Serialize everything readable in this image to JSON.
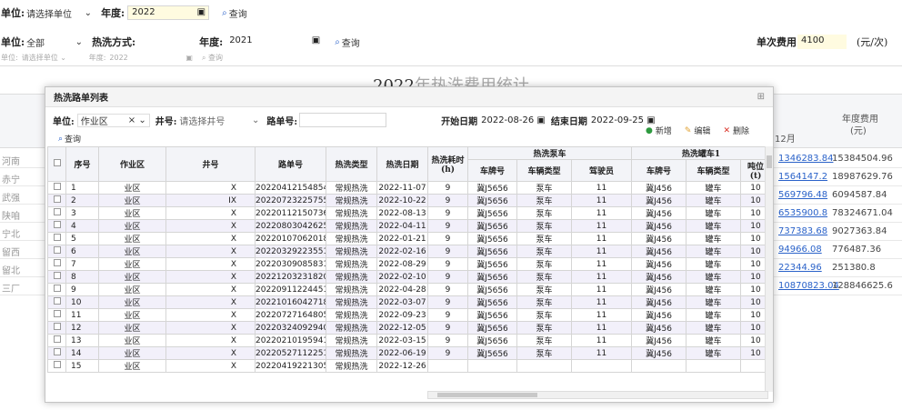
{
  "top1": {
    "unit_label": "单位:",
    "unit_value": "请选择单位",
    "year_label": "年度:",
    "year_value": "2022",
    "query": "查询"
  },
  "top2": {
    "unit_label": "单位:",
    "unit_value": "全部",
    "method_label": "热洗方式:",
    "year_label": "年度:",
    "year_value": "2021",
    "query": "查询",
    "fee_label": "单次费用:",
    "fee_value": "4100",
    "fee_unit": "(元/次)"
  },
  "top3": {
    "unit_label": "单位:",
    "unit_value": "请选择单位",
    "year_label": "年度:",
    "year_value": "2022",
    "query": "查询"
  },
  "bg": {
    "title_dark": "2022",
    "title_light": "年热洗费用统计",
    "col_dec": "12月",
    "col_year": "年度费用",
    "col_year_unit": "(元)",
    "rows": [
      {
        "name": "河南",
        "dec": "1346283.84",
        "year": "15384504.96"
      },
      {
        "name": "赤宁",
        "dec": "1564147.2",
        "year": "18987629.76"
      },
      {
        "name": "武强",
        "dec": "569796.48",
        "year": "6094587.84"
      },
      {
        "name": "陕咱",
        "dec": "6535900.8",
        "year": "78324671.04"
      },
      {
        "name": "宁北",
        "dec": "737383.68",
        "year": "9027363.84"
      },
      {
        "name": "留西",
        "dec": "94966.08",
        "year": "776487.36"
      },
      {
        "name": "留北",
        "dec": "22344.96",
        "year": "251380.8"
      },
      {
        "name": "三厂",
        "dec": "10870823.04",
        "year": "128846625.6"
      }
    ]
  },
  "dialog": {
    "title": "热洗路单列表",
    "unit_label": "单位:",
    "unit_value": "作业区",
    "well_label": "井号:",
    "well_placeholder": "请选择井号",
    "route_label": "路单号:",
    "start_label": "开始日期",
    "start_value": "2022-08-26",
    "end_label": "结束日期",
    "end_value": "2022-09-25",
    "add": "新增",
    "edit": "编辑",
    "del": "删除",
    "query": "查询",
    "headers": {
      "seq": "序号",
      "area": "作业区",
      "well": "井号",
      "route": "路单号",
      "type": "热洗类型",
      "date": "热洗日期",
      "dur": "热洗耗时",
      "dur_unit": "(h)",
      "pump_group": "热洗泵车",
      "tank_group": "热洗罐车1",
      "plate": "车牌号",
      "vtype": "车辆类型",
      "driver": "驾驶员",
      "plate2": "车牌号",
      "vtype2": "车辆类型",
      "ton": "吨位",
      "ton_unit": "(t)"
    },
    "rows": [
      {
        "n": "1",
        "a": "业区",
        "w": "X",
        "r": "20220412154854",
        "t": "常规热洗",
        "d": "2022-11-07",
        "h": "9",
        "p": "冀J5656",
        "v": "泵车",
        "dr": "11",
        "p2": "冀J456",
        "v2": "罐车",
        "ton": "10"
      },
      {
        "n": "2",
        "a": "业区",
        "w": "IX",
        "r": "20220723225755",
        "t": "常规热洗",
        "d": "2022-10-22",
        "h": "9",
        "p": "冀J5656",
        "v": "泵车",
        "dr": "11",
        "p2": "冀J456",
        "v2": "罐车",
        "ton": "10"
      },
      {
        "n": "3",
        "a": "业区",
        "w": "X",
        "r": "20220112150736",
        "t": "常规热洗",
        "d": "2022-08-13",
        "h": "9",
        "p": "冀J5656",
        "v": "泵车",
        "dr": "11",
        "p2": "冀J456",
        "v2": "罐车",
        "ton": "10"
      },
      {
        "n": "4",
        "a": "业区",
        "w": "X",
        "r": "20220803042625",
        "t": "常规热洗",
        "d": "2022-04-11",
        "h": "9",
        "p": "冀J5656",
        "v": "泵车",
        "dr": "11",
        "p2": "冀J456",
        "v2": "罐车",
        "ton": "10"
      },
      {
        "n": "5",
        "a": "业区",
        "w": "X",
        "r": "20220107062018",
        "t": "常规热洗",
        "d": "2022-01-21",
        "h": "9",
        "p": "冀J5656",
        "v": "泵车",
        "dr": "11",
        "p2": "冀J456",
        "v2": "罐车",
        "ton": "10"
      },
      {
        "n": "6",
        "a": "业区",
        "w": "X",
        "r": "20220329223551",
        "t": "常规热洗",
        "d": "2022-02-16",
        "h": "9",
        "p": "冀J5656",
        "v": "泵车",
        "dr": "11",
        "p2": "冀J456",
        "v2": "罐车",
        "ton": "10"
      },
      {
        "n": "7",
        "a": "业区",
        "w": "X",
        "r": "20220309085831",
        "t": "常规热洗",
        "d": "2022-08-29",
        "h": "9",
        "p": "冀J5656",
        "v": "泵车",
        "dr": "11",
        "p2": "冀J456",
        "v2": "罐车",
        "ton": "10"
      },
      {
        "n": "8",
        "a": "业区",
        "w": "X",
        "r": "20221203231820",
        "t": "常规热洗",
        "d": "2022-02-10",
        "h": "9",
        "p": "冀J5656",
        "v": "泵车",
        "dr": "11",
        "p2": "冀J456",
        "v2": "罐车",
        "ton": "10"
      },
      {
        "n": "9",
        "a": "业区",
        "w": "X",
        "r": "20220911224451",
        "t": "常规热洗",
        "d": "2022-04-28",
        "h": "9",
        "p": "冀J5656",
        "v": "泵车",
        "dr": "11",
        "p2": "冀J456",
        "v2": "罐车",
        "ton": "10"
      },
      {
        "n": "10",
        "a": "业区",
        "w": "X",
        "r": "20221016042718",
        "t": "常规热洗",
        "d": "2022-03-07",
        "h": "9",
        "p": "冀J5656",
        "v": "泵车",
        "dr": "11",
        "p2": "冀J456",
        "v2": "罐车",
        "ton": "10"
      },
      {
        "n": "11",
        "a": "业区",
        "w": "X",
        "r": "20220727164805",
        "t": "常规热洗",
        "d": "2022-09-23",
        "h": "9",
        "p": "冀J5656",
        "v": "泵车",
        "dr": "11",
        "p2": "冀J456",
        "v2": "罐车",
        "ton": "10"
      },
      {
        "n": "12",
        "a": "业区",
        "w": "X",
        "r": "20220324092940",
        "t": "常规热洗",
        "d": "2022-12-05",
        "h": "9",
        "p": "冀J5656",
        "v": "泵车",
        "dr": "11",
        "p2": "冀J456",
        "v2": "罐车",
        "ton": "10"
      },
      {
        "n": "13",
        "a": "业区",
        "w": "X",
        "r": "20220210195941",
        "t": "常规热洗",
        "d": "2022-03-15",
        "h": "9",
        "p": "冀J5656",
        "v": "泵车",
        "dr": "11",
        "p2": "冀J456",
        "v2": "罐车",
        "ton": "10"
      },
      {
        "n": "14",
        "a": "业区",
        "w": "X",
        "r": "20220527112251",
        "t": "常规热洗",
        "d": "2022-06-19",
        "h": "9",
        "p": "冀J5656",
        "v": "泵车",
        "dr": "11",
        "p2": "冀J456",
        "v2": "罐车",
        "ton": "10"
      },
      {
        "n": "15",
        "a": "业区",
        "w": "X",
        "r": "20220419221305",
        "t": "常规热洗",
        "d": "2022-12-26",
        "h": "",
        "p": "",
        "v": "",
        "dr": "",
        "p2": "",
        "v2": "",
        "ton": ""
      }
    ]
  },
  "colors": {
    "link": "#2a62c9",
    "row_alt": "#f2f0fa",
    "header_bg": "#f3f4f8",
    "delete": "#d93025",
    "add": "#2e9a3f"
  },
  "icons": [
    "search-icon",
    "calendar-icon",
    "chevron-down-icon",
    "close-icon",
    "add-icon",
    "edit-icon",
    "delete-icon",
    "maximize-icon"
  ]
}
